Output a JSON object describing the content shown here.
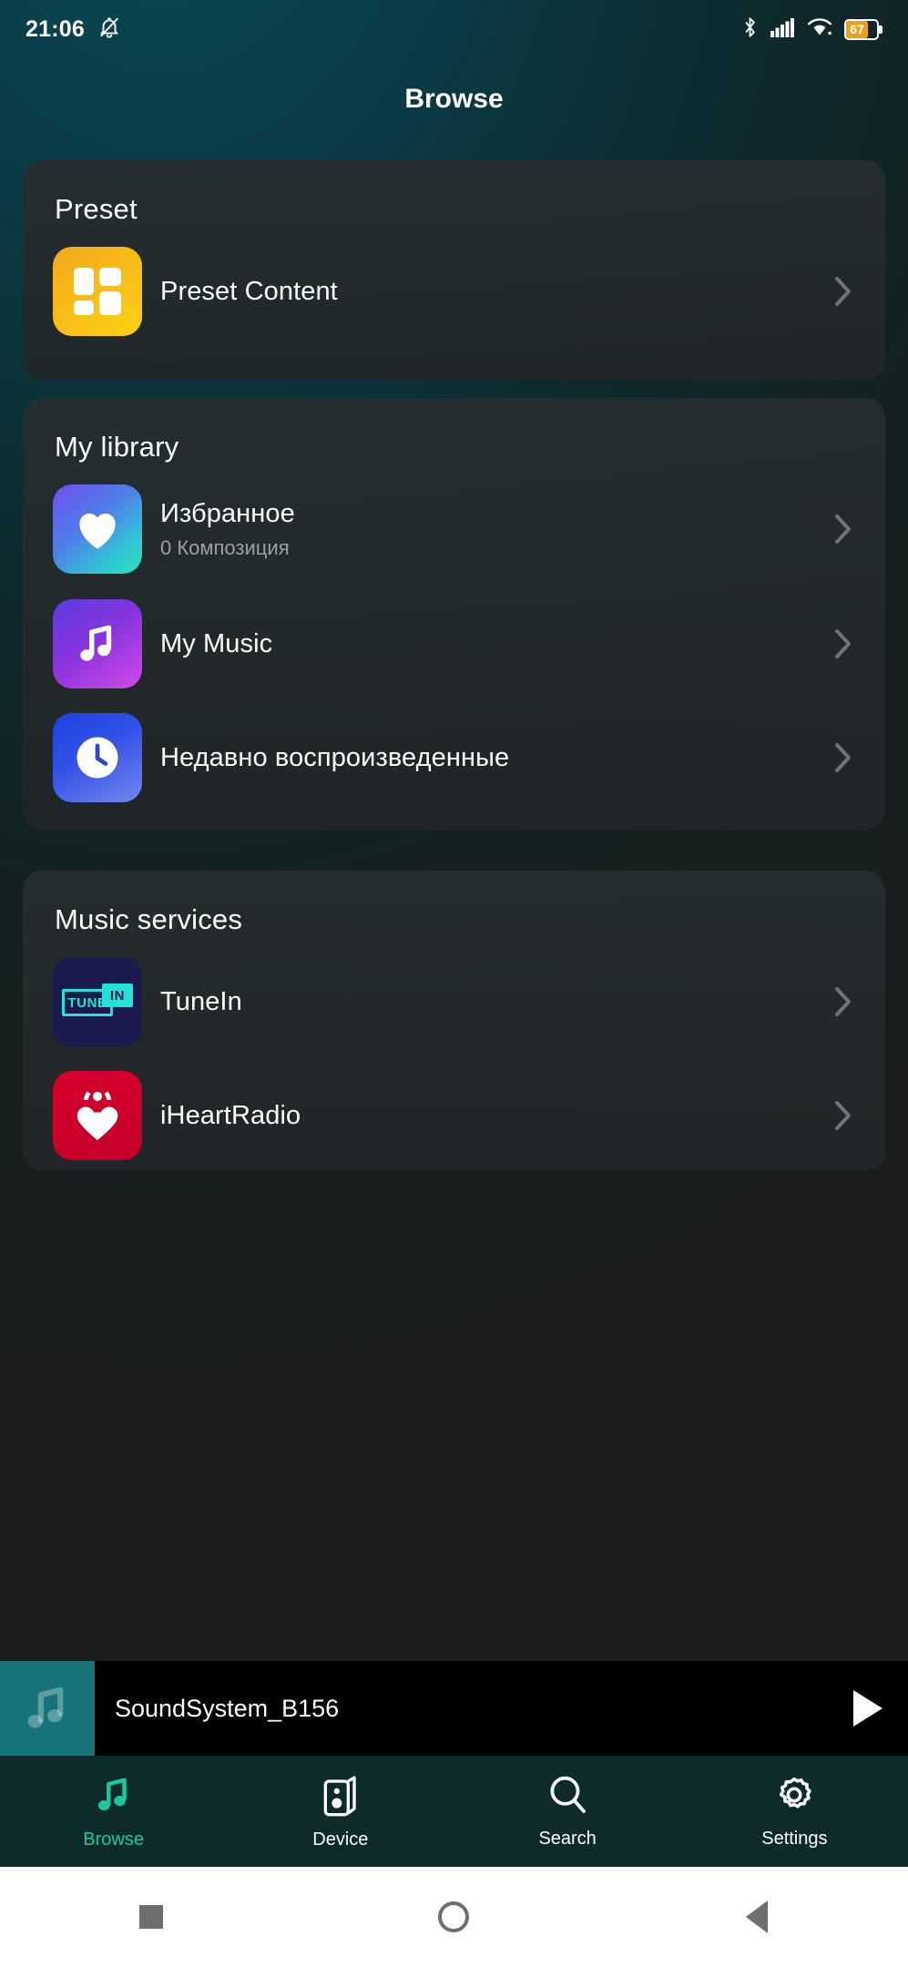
{
  "status_bar": {
    "time": "21:06",
    "mute_icon": "bell-muted-icon",
    "bluetooth_icon": "bluetooth-icon",
    "signal_icon": "cellular-signal-icon",
    "wifi_icon": "wifi-icon",
    "battery_percent": "67",
    "battery_color": "#e8a317"
  },
  "header": {
    "title": "Browse"
  },
  "sections": [
    {
      "title": "Preset",
      "rows": [
        {
          "label": "Preset Content",
          "sub": "",
          "icon": "preset-grid-icon",
          "chevron": "chevron-right-icon"
        }
      ]
    },
    {
      "title": "My library",
      "rows": [
        {
          "label": "Избранное",
          "sub": "0   Композиция",
          "icon": "heart-icon",
          "chevron": "chevron-right-icon"
        },
        {
          "label": "My Music",
          "sub": "",
          "icon": "music-note-icon",
          "chevron": "chevron-right-icon"
        },
        {
          "label": "Недавно воспроизведенные",
          "sub": "",
          "icon": "clock-icon",
          "chevron": "chevron-right-icon"
        }
      ]
    },
    {
      "title": "Music services",
      "rows": [
        {
          "label": "TuneIn",
          "sub": "",
          "icon": "tunein-logo-icon",
          "chevron": "chevron-right-icon",
          "tune_text": "TUNE",
          "in_text": "IN"
        },
        {
          "label": "iHeartRadio",
          "sub": "",
          "icon": "iheartradio-logo-icon",
          "chevron": "chevron-right-icon"
        }
      ]
    }
  ],
  "player": {
    "track_title": "SoundSystem_B156",
    "art_icon": "music-note-icon",
    "play_icon": "play-icon"
  },
  "bottom_nav": {
    "active_color": "#19c8a0",
    "items": [
      {
        "label": "Browse",
        "icon": "music-note-icon",
        "active": true
      },
      {
        "label": "Device",
        "icon": "speaker-icon",
        "active": false
      },
      {
        "label": "Search",
        "icon": "search-icon",
        "active": false
      },
      {
        "label": "Settings",
        "icon": "gear-icon",
        "active": false
      }
    ]
  },
  "system_bar": {
    "recents": "square-icon",
    "home": "circle-icon",
    "back": "triangle-back-icon"
  }
}
